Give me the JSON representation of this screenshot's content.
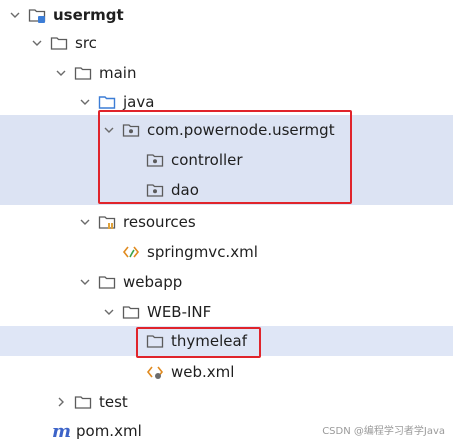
{
  "tree": {
    "items": [
      {
        "label": "usermgt",
        "icon": "module-folder-icon",
        "chevron": "down"
      },
      {
        "label": "src",
        "icon": "folder-icon",
        "chevron": "down"
      },
      {
        "label": "main",
        "icon": "folder-icon",
        "chevron": "down"
      },
      {
        "label": "java",
        "icon": "source-folder-icon",
        "chevron": "down"
      },
      {
        "label": "com.powernode.usermgt",
        "icon": "package-icon",
        "chevron": "down"
      },
      {
        "label": "controller",
        "icon": "package-icon",
        "chevron": ""
      },
      {
        "label": "dao",
        "icon": "package-icon",
        "chevron": ""
      },
      {
        "label": "resources",
        "icon": "resources-folder-icon",
        "chevron": "down"
      },
      {
        "label": "springmvc.xml",
        "icon": "xml-file-icon",
        "chevron": ""
      },
      {
        "label": "webapp",
        "icon": "folder-icon",
        "chevron": "down"
      },
      {
        "label": "WEB-INF",
        "icon": "folder-icon",
        "chevron": "down"
      },
      {
        "label": "thymeleaf",
        "icon": "folder-icon",
        "chevron": ""
      },
      {
        "label": "web.xml",
        "icon": "xml-file-icon",
        "chevron": ""
      },
      {
        "label": "test",
        "icon": "folder-icon",
        "chevron": "right"
      },
      {
        "label": "pom.xml",
        "icon": "maven-icon",
        "chevron": ""
      }
    ]
  },
  "watermark": "CSDN @编程学习者学Java",
  "colors": {
    "selection": "#dce3f3",
    "highlight_box": "#e0242b",
    "maven": "#3c63c8"
  }
}
